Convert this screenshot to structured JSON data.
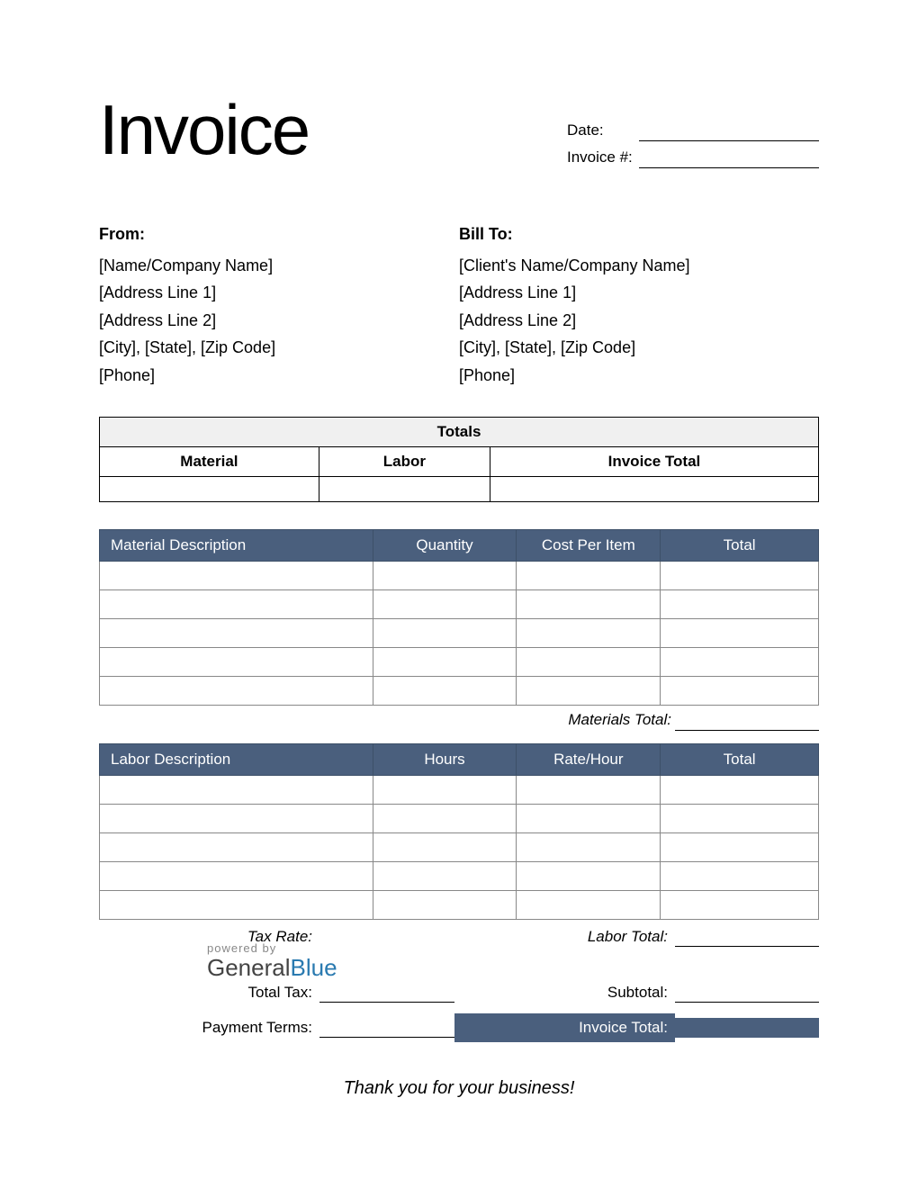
{
  "title": "Invoice",
  "meta": {
    "date_label": "Date:",
    "date_value": "",
    "invoice_no_label": "Invoice #:",
    "invoice_no_value": ""
  },
  "from": {
    "title": "From:",
    "lines": [
      "[Name/Company Name]",
      "[Address Line 1]",
      "[Address Line 2]",
      "[City], [State], [Zip Code]",
      "[Phone]"
    ]
  },
  "bill_to": {
    "title": "Bill To:",
    "lines": [
      "[Client's Name/Company Name]",
      "[Address Line 1]",
      "[Address Line 2]",
      "[City], [State], [Zip Code]",
      "[Phone]"
    ]
  },
  "totals_summary": {
    "header": "Totals",
    "material_label": "Material",
    "labor_label": "Labor",
    "invoice_total_label": "Invoice Total",
    "material_value": "",
    "labor_value": "",
    "invoice_total_value": ""
  },
  "materials_table": {
    "cols": [
      "Material Description",
      "Quantity",
      "Cost Per Item",
      "Total"
    ],
    "row_count": 5,
    "subtotal_label": "Materials Total:",
    "subtotal_value": ""
  },
  "labor_table": {
    "cols": [
      "Labor Description",
      "Hours",
      "Rate/Hour",
      "Total"
    ],
    "row_count": 5,
    "subtotal_label": "Labor Total:",
    "subtotal_value": ""
  },
  "footer": {
    "tax_rate_label": "Tax Rate:",
    "tax_rate_value": "",
    "total_tax_label": "Total Tax:",
    "total_tax_value": "",
    "payment_terms_label": "Payment Terms:",
    "payment_terms_value": "",
    "subtotal_label": "Subtotal:",
    "subtotal_value": "",
    "invoice_total_label": "Invoice Total:",
    "invoice_total_value": ""
  },
  "thanks": "Thank you for your business!",
  "brand": {
    "powered_by": "powered by",
    "name1": "General",
    "name2": "Blue"
  },
  "colors": {
    "accent": "#4a5f7d"
  }
}
